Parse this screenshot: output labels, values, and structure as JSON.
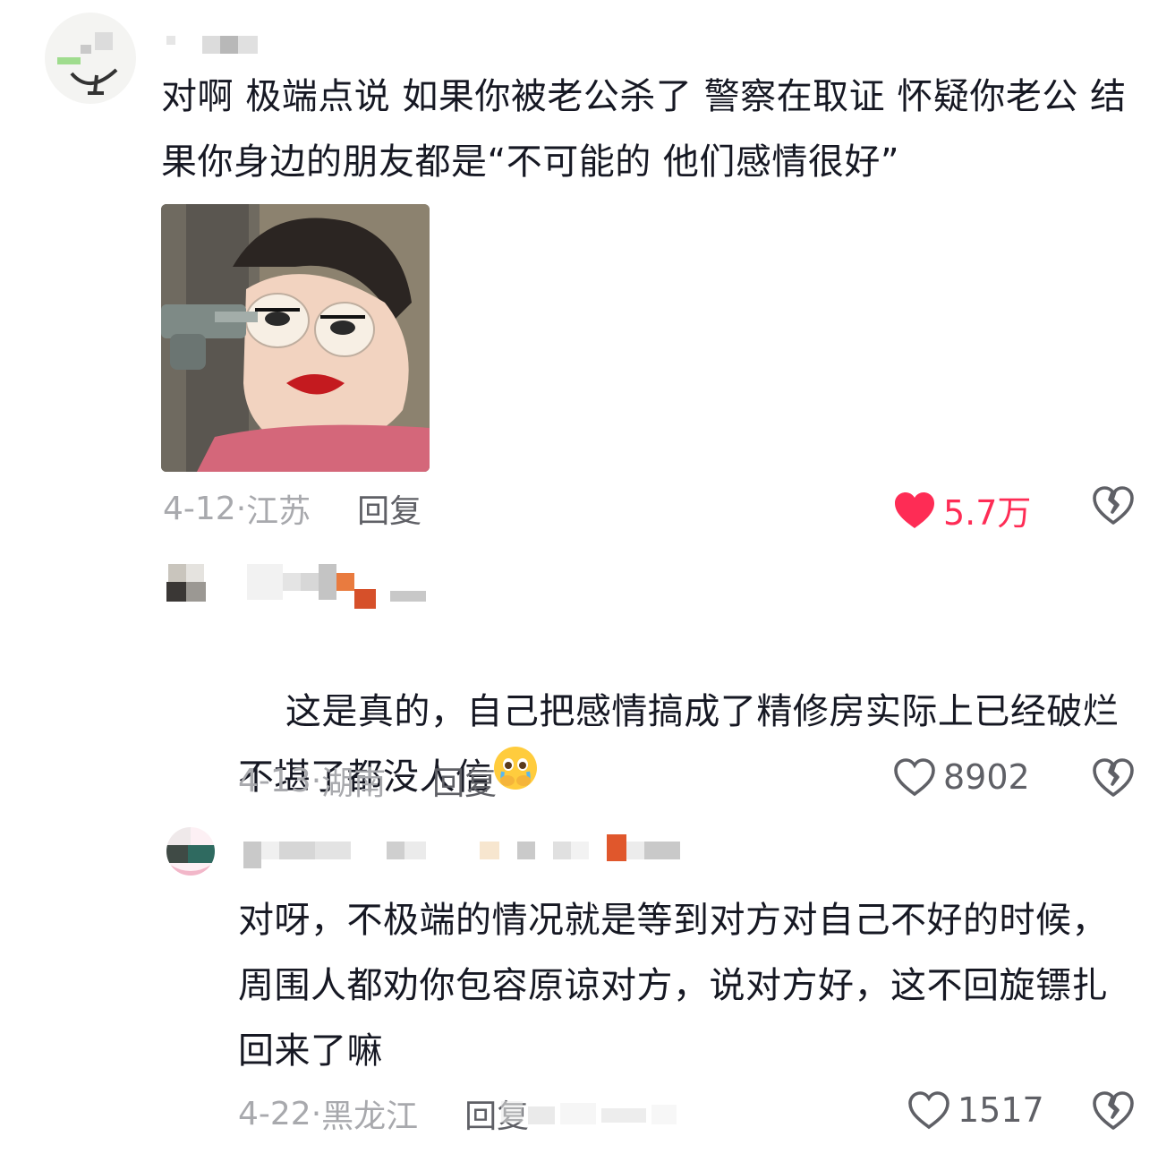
{
  "comments": [
    {
      "text": "对啊 极端点说 如果你被老公杀了 警察在取证 怀疑你老公 结果你身边的朋友都是“不可能的 他们感情很好”",
      "date": "4-12",
      "location": "江苏",
      "reply_label": "回复",
      "likes": "5.7万",
      "liked": true
    },
    {
      "text": "这是真的，自己把感情搞成了精修房实际上已经破烂不堪了都没人信",
      "emoji": "crying-face-emoji",
      "date": "4-13",
      "location": "湖南",
      "reply_label": "回复",
      "likes": "8902",
      "liked": false
    },
    {
      "text": "对呀，不极端的情况就是等到对方对自己不好的时候，周围人都劝你包容原谅对方，说对方好，这不回旋镖扎回来了嘛",
      "date": "4-22",
      "location": "黑龙江",
      "reply_label": "回复",
      "likes": "1517",
      "liked": false
    }
  ],
  "colors": {
    "text": "#161823",
    "meta": "#a8a9ad",
    "reply": "#5f6066",
    "like_active": "#fe2c55"
  },
  "icons": [
    "heart-filled-icon",
    "heart-outline-icon",
    "broken-heart-icon"
  ]
}
